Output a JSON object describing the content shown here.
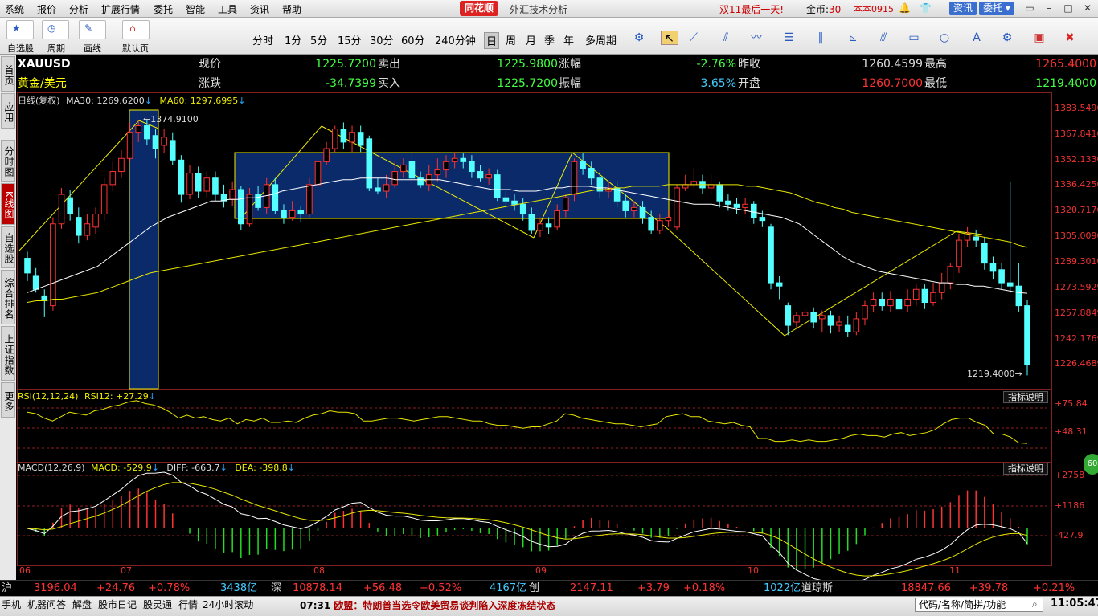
{
  "menu": {
    "items": [
      "系统",
      "报价",
      "分析",
      "扩展行情",
      "委托",
      "智能",
      "工具",
      "资讯",
      "帮助"
    ],
    "brand": "同花顺",
    "title": "- 外汇技术分析",
    "promo": "双11最后一天!",
    "gold_label": "金币:",
    "gold_value": "30",
    "version": "本本0915",
    "btn_news": "资讯",
    "btn_trade": "委托"
  },
  "toolbar": {
    "tools": [
      "自选股",
      "周期",
      "画线",
      "默认页"
    ],
    "periods": [
      "分时",
      "1分",
      "5分",
      "15分",
      "30分",
      "60分",
      "240分钟",
      "日",
      "周",
      "月",
      "季",
      "年",
      "多周期"
    ],
    "selected_period": "日"
  },
  "leftnav": [
    "首页",
    "应用",
    "分时图",
    "K线图",
    "自选股",
    "综合排名",
    "上证指数",
    "更多"
  ],
  "quote": {
    "symbol": "XAUUSD",
    "name": "黄金/美元",
    "price_label": "现价",
    "price": "1225.7200",
    "sell_label": "卖出",
    "sell": "1225.9800",
    "pct_label": "涨幅",
    "pct": "-2.76%",
    "prev_label": "昨收",
    "prev": "1260.4599",
    "high_label": "最高",
    "high": "1265.4000",
    "chg_label": "涨跌",
    "chg": "-34.7399",
    "buy_label": "买入",
    "buy": "1225.7200",
    "amp_label": "振幅",
    "amp": "3.65%",
    "open_label": "开盘",
    "open": "1260.7000",
    "low_label": "最低",
    "low": "1219.4000"
  },
  "chart_data": [
    {
      "type": "candlestick",
      "title": "日线(复权)",
      "indicators": [
        {
          "name": "MA30",
          "value": "1269.6200",
          "color": "#ffffff"
        },
        {
          "name": "MA60",
          "value": "1297.6995",
          "color": "#e6e600"
        }
      ],
      "ylim": [
        1219,
        1384
      ],
      "y_ticks": [
        "1383.5490",
        "1367.8410",
        "1352.1330",
        "1336.4250",
        "1320.7170",
        "1305.0090",
        "1289.3010",
        "1273.5929",
        "1257.8849",
        "1242.1769",
        "1226.4689"
      ],
      "x_ticks": [
        "06",
        "07",
        "08",
        "09",
        "10",
        "11"
      ],
      "annotations": [
        "1374.9100",
        "1219.4000"
      ],
      "candles": [
        [
          1291,
          1282,
          1295,
          1277
        ],
        [
          1280,
          1272,
          1285,
          1270
        ],
        [
          1268,
          1265,
          1272,
          1255
        ],
        [
          1262,
          1312,
          1316,
          1259
        ],
        [
          1312,
          1330,
          1334,
          1309
        ],
        [
          1328,
          1318,
          1333,
          1314
        ],
        [
          1316,
          1305,
          1322,
          1300
        ],
        [
          1305,
          1312,
          1318,
          1302
        ],
        [
          1310,
          1318,
          1322,
          1306
        ],
        [
          1318,
          1336,
          1340,
          1314
        ],
        [
          1336,
          1344,
          1350,
          1332
        ],
        [
          1344,
          1352,
          1357,
          1340
        ],
        [
          1352,
          1368,
          1374,
          1350
        ],
        [
          1368,
          1372,
          1375,
          1362
        ],
        [
          1372,
          1364,
          1376,
          1360
        ],
        [
          1366,
          1358,
          1370,
          1352
        ],
        [
          1360,
          1365,
          1370,
          1355
        ],
        [
          1363,
          1351,
          1368,
          1348
        ],
        [
          1351,
          1330,
          1354,
          1325
        ],
        [
          1330,
          1343,
          1348,
          1327
        ],
        [
          1343,
          1332,
          1347,
          1328
        ],
        [
          1332,
          1340,
          1344,
          1328
        ],
        [
          1340,
          1330,
          1344,
          1326
        ],
        [
          1330,
          1326,
          1336,
          1322
        ],
        [
          1327,
          1333,
          1338,
          1323
        ],
        [
          1333,
          1312,
          1335,
          1308
        ],
        [
          1312,
          1330,
          1334,
          1310
        ],
        [
          1330,
          1322,
          1335,
          1320
        ],
        [
          1322,
          1336,
          1340,
          1318
        ],
        [
          1336,
          1320,
          1340,
          1318
        ],
        [
          1320,
          1316,
          1324,
          1312
        ],
        [
          1316,
          1320,
          1326,
          1314
        ],
        [
          1320,
          1318,
          1323,
          1313
        ],
        [
          1318,
          1336,
          1340,
          1316
        ],
        [
          1336,
          1350,
          1354,
          1332
        ],
        [
          1350,
          1358,
          1362,
          1348
        ],
        [
          1358,
          1370,
          1372,
          1356
        ],
        [
          1370,
          1362,
          1374,
          1358
        ],
        [
          1362,
          1368,
          1372,
          1356
        ],
        [
          1368,
          1360,
          1372,
          1356
        ],
        [
          1364,
          1334,
          1366,
          1332
        ],
        [
          1334,
          1332,
          1340,
          1330
        ],
        [
          1332,
          1336,
          1342,
          1328
        ],
        [
          1336,
          1344,
          1350,
          1334
        ],
        [
          1344,
          1348,
          1352,
          1340
        ],
        [
          1350,
          1340,
          1355,
          1336
        ],
        [
          1340,
          1336,
          1344,
          1334
        ],
        [
          1336,
          1342,
          1348,
          1332
        ],
        [
          1342,
          1345,
          1352,
          1338
        ],
        [
          1345,
          1350,
          1354,
          1340
        ],
        [
          1350,
          1352,
          1356,
          1346
        ],
        [
          1352,
          1350,
          1355,
          1346
        ],
        [
          1350,
          1344,
          1354,
          1340
        ],
        [
          1344,
          1340,
          1348,
          1338
        ],
        [
          1340,
          1342,
          1346,
          1336
        ],
        [
          1342,
          1328,
          1345,
          1326
        ],
        [
          1328,
          1326,
          1332,
          1322
        ],
        [
          1326,
          1324,
          1330,
          1320
        ],
        [
          1324,
          1318,
          1328,
          1314
        ],
        [
          1318,
          1308,
          1322,
          1306
        ],
        [
          1308,
          1312,
          1316,
          1304
        ],
        [
          1312,
          1310,
          1316,
          1306
        ],
        [
          1310,
          1320,
          1324,
          1308
        ],
        [
          1320,
          1328,
          1330,
          1316
        ],
        [
          1330,
          1350,
          1352,
          1326
        ],
        [
          1350,
          1346,
          1355,
          1342
        ],
        [
          1346,
          1340,
          1350,
          1336
        ],
        [
          1340,
          1332,
          1344,
          1328
        ],
        [
          1332,
          1334,
          1338,
          1328
        ],
        [
          1334,
          1326,
          1338,
          1322
        ],
        [
          1326,
          1320,
          1330,
          1316
        ],
        [
          1320,
          1322,
          1326,
          1316
        ],
        [
          1322,
          1316,
          1326,
          1312
        ],
        [
          1316,
          1308,
          1320,
          1306
        ],
        [
          1308,
          1314,
          1318,
          1306
        ],
        [
          1314,
          1316,
          1320,
          1310
        ],
        [
          1310,
          1334,
          1336,
          1308
        ],
        [
          1334,
          1336,
          1342,
          1332
        ],
        [
          1336,
          1338,
          1346,
          1334
        ],
        [
          1338,
          1334,
          1342,
          1330
        ],
        [
          1334,
          1336,
          1342,
          1330
        ],
        [
          1336,
          1326,
          1338,
          1322
        ],
        [
          1326,
          1324,
          1330,
          1320
        ],
        [
          1324,
          1322,
          1328,
          1318
        ],
        [
          1322,
          1324,
          1328,
          1318
        ],
        [
          1324,
          1316,
          1326,
          1312
        ],
        [
          1316,
          1314,
          1320,
          1310
        ],
        [
          1310,
          1276,
          1312,
          1272
        ],
        [
          1276,
          1274,
          1280,
          1266
        ],
        [
          1262,
          1250,
          1264,
          1244
        ],
        [
          1252,
          1256,
          1258,
          1248
        ],
        [
          1256,
          1258,
          1261,
          1250
        ],
        [
          1258,
          1252,
          1261,
          1248
        ],
        [
          1254,
          1256,
          1259,
          1246
        ],
        [
          1256,
          1250,
          1259,
          1245
        ],
        [
          1250,
          1252,
          1256,
          1246
        ],
        [
          1250,
          1246,
          1256,
          1243
        ],
        [
          1246,
          1254,
          1258,
          1244
        ],
        [
          1254,
          1262,
          1265,
          1250
        ],
        [
          1262,
          1266,
          1270,
          1258
        ],
        [
          1266,
          1262,
          1270,
          1259
        ],
        [
          1262,
          1266,
          1271,
          1258
        ],
        [
          1266,
          1260,
          1270,
          1258
        ],
        [
          1262,
          1266,
          1272,
          1258
        ],
        [
          1266,
          1272,
          1275,
          1262
        ],
        [
          1272,
          1264,
          1275,
          1260
        ],
        [
          1264,
          1270,
          1276,
          1262
        ],
        [
          1270,
          1276,
          1282,
          1266
        ],
        [
          1276,
          1286,
          1288,
          1272
        ],
        [
          1286,
          1302,
          1306,
          1282
        ],
        [
          1302,
          1306,
          1310,
          1298
        ],
        [
          1304,
          1302,
          1308,
          1298
        ],
        [
          1300,
          1288,
          1304,
          1284
        ],
        [
          1288,
          1283,
          1292,
          1278
        ],
        [
          1284,
          1276,
          1288,
          1272
        ],
        [
          1276,
          1274,
          1338,
          1270
        ],
        [
          1274,
          1262,
          1288,
          1258
        ],
        [
          1262,
          1225.72,
          1265.4,
          1219.4
        ]
      ],
      "ma30": [
        1270,
        1272,
        1274,
        1276,
        1278,
        1280,
        1282,
        1284,
        1286,
        1290,
        1294,
        1298,
        1302,
        1306,
        1310,
        1313,
        1316,
        1318,
        1320,
        1322,
        1324,
        1326,
        1326,
        1327,
        1327,
        1328,
        1328,
        1329,
        1330,
        1332,
        1333,
        1334,
        1335,
        1336,
        1337,
        1338,
        1339,
        1339,
        1340,
        1340,
        1340,
        1340,
        1339,
        1339,
        1339,
        1339,
        1339,
        1339,
        1338,
        1337,
        1336,
        1335,
        1334,
        1333,
        1333,
        1333,
        1332,
        1332,
        1332,
        1333,
        1334,
        1334,
        1335,
        1335,
        1335,
        1334,
        1334,
        1333,
        1332,
        1331,
        1330,
        1329,
        1328,
        1327,
        1326,
        1325,
        1324,
        1324,
        1324,
        1323,
        1322,
        1321,
        1320,
        1319,
        1318,
        1317,
        1316,
        1314,
        1312,
        1308,
        1304,
        1300,
        1296,
        1292,
        1289,
        1287,
        1285,
        1283,
        1282,
        1281,
        1280,
        1279,
        1278,
        1277,
        1276,
        1276,
        1275,
        1275,
        1274,
        1274,
        1273,
        1272,
        1271,
        1270,
        1269.62
      ],
      "ma60": [
        1264,
        1265,
        1265,
        1266,
        1266,
        1267,
        1268,
        1269,
        1270,
        1272,
        1274,
        1276,
        1278,
        1280,
        1282,
        1283,
        1284,
        1285,
        1286,
        1287,
        1288,
        1289,
        1290,
        1291,
        1292,
        1293,
        1294,
        1295,
        1296,
        1297,
        1298,
        1299,
        1300,
        1301,
        1302,
        1303,
        1304,
        1305,
        1306,
        1307,
        1308,
        1309,
        1310,
        1311,
        1312,
        1313,
        1314,
        1315,
        1316,
        1317,
        1318,
        1319,
        1320,
        1321,
        1322,
        1323,
        1324,
        1325,
        1326,
        1327,
        1328,
        1329,
        1330,
        1331,
        1332,
        1333,
        1333,
        1334,
        1334,
        1335,
        1335,
        1335,
        1335,
        1336,
        1336,
        1336,
        1336,
        1336,
        1336,
        1336,
        1336,
        1336,
        1335,
        1335,
        1334,
        1333,
        1332,
        1331,
        1329,
        1327,
        1325,
        1324,
        1322,
        1321,
        1319,
        1318,
        1317,
        1316,
        1315,
        1314,
        1313,
        1312,
        1311,
        1310,
        1309,
        1308,
        1307,
        1306,
        1305,
        1304,
        1303,
        1302,
        1301,
        1299,
        1297.7
      ]
    },
    {
      "type": "line",
      "title": "RSI(12,12,24)",
      "indicators": [
        {
          "name": "RSI12",
          "value": "+27.29",
          "color": "#e6e600"
        }
      ],
      "y_ticks": [
        "+75.84",
        "+48.31"
      ],
      "ylim": [
        20,
        90
      ],
      "values": [
        70,
        68,
        62,
        58,
        64,
        70,
        68,
        66,
        72,
        74,
        78,
        80,
        84,
        86,
        82,
        80,
        76,
        70,
        62,
        66,
        62,
        64,
        60,
        58,
        62,
        54,
        60,
        58,
        62,
        56,
        56,
        58,
        56,
        62,
        66,
        68,
        72,
        70,
        70,
        68,
        58,
        58,
        60,
        62,
        62,
        60,
        58,
        60,
        62,
        64,
        64,
        62,
        60,
        58,
        58,
        54,
        52,
        52,
        50,
        48,
        50,
        50,
        54,
        58,
        68,
        66,
        62,
        60,
        58,
        56,
        54,
        54,
        52,
        50,
        52,
        54,
        64,
        66,
        68,
        64,
        64,
        58,
        56,
        54,
        56,
        52,
        50,
        34,
        34,
        30,
        30,
        32,
        30,
        32,
        30,
        30,
        32,
        34,
        38,
        40,
        38,
        38,
        36,
        40,
        42,
        38,
        40,
        42,
        46,
        54,
        60,
        62,
        62,
        56,
        52,
        40,
        40,
        36,
        28,
        27.29
      ]
    },
    {
      "type": "histogram+line",
      "title": "MACD(12,26,9)",
      "indicators": [
        {
          "name": "MACD",
          "value": "-529.9",
          "color": "#ffffff"
        },
        {
          "name": "DIFF",
          "value": "-663.7",
          "color": "#ffffff"
        },
        {
          "name": "DEA",
          "value": "-398.8",
          "color": "#e6e600"
        }
      ],
      "y_ticks": [
        "+2758",
        "+1186",
        "-427.9"
      ],
      "ylim": [
        -2400,
        3600
      ]
    }
  ],
  "ticker": {
    "sh_label": "沪",
    "sh_val": "3196.04",
    "sh_chg": "+24.76",
    "sh_pct": "+0.78%",
    "sh_amt": "3438亿",
    "sz_label": "深",
    "sz_val": "10878.14",
    "sz_chg": "+56.48",
    "sz_pct": "+0.52%",
    "sz_amt": "4167亿",
    "cy_label": "创",
    "cy_val": "2147.11",
    "cy_chg": "+3.79",
    "cy_pct": "+0.18%",
    "cy_amt": "1022亿",
    "dj_label": "道琼斯",
    "dj_val": "18847.66",
    "dj_chg": "+39.78",
    "dj_pct": "+0.21%"
  },
  "status": {
    "buttons": [
      "手机",
      "机器问答",
      "解盘",
      "股市日记",
      "股灵通",
      "行情",
      "24小时滚动"
    ],
    "news_time": "07:31",
    "news": "欧盟：特朗普当选令欧美贸易谈判陷入深度冻结状态",
    "search_placeholder": "代码/名称/简拼/功能",
    "clock": "11:05:47"
  },
  "panel": {
    "explain": "指标说明",
    "badge": "60"
  }
}
